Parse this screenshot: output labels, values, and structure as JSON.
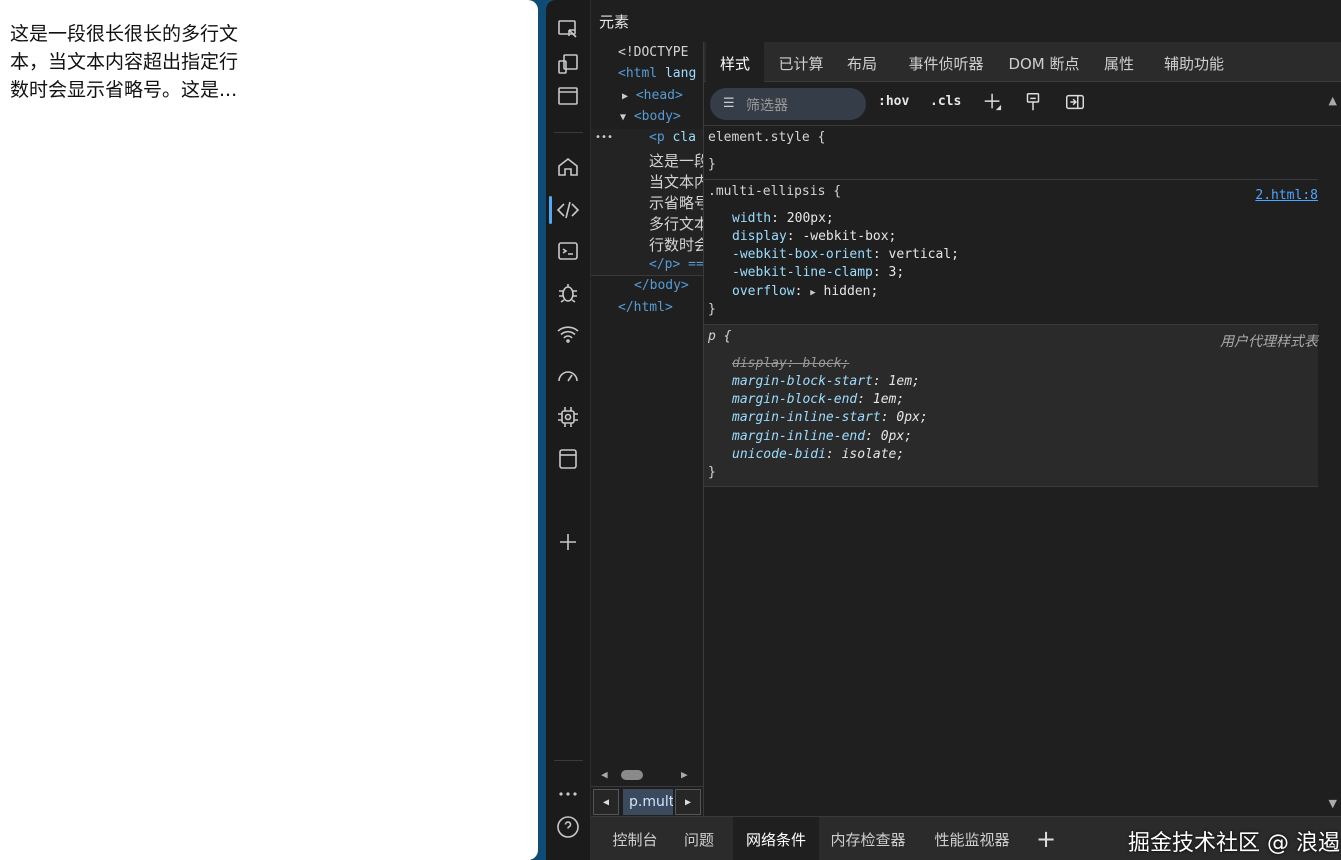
{
  "page": {
    "text": "这是一段很长很长的多行文\n本，当文本内容超出指定行\n数时会显示省略号。这是..."
  },
  "devtools": {
    "title": "元素",
    "dom": {
      "doctype": "<!DOCTYPE",
      "html_tag": "<html",
      "html_attr": "lang",
      "head": "<head>",
      "body": "<body>",
      "p_tag": "<p",
      "p_attr": "cla",
      "text_lines": [
        "这是一段",
        "当文本内",
        "示省略号",
        "多行文本",
        "行数时会"
      ],
      "p_close": "</p> ==",
      "body_close": "</body>",
      "html_close": "</html>",
      "ellipsis": "•••"
    },
    "breadcrumb": "p.mult",
    "style_tabs": [
      "样式",
      "已计算",
      "布局",
      "事件侦听器",
      "DOM 断点",
      "属性",
      "辅助功能"
    ],
    "filter_placeholder": "筛选器",
    "hov": ":hov",
    "cls": ".cls",
    "rules": {
      "element_style": "element.style {",
      "close": "}",
      "multi_selector": ".multi-ellipsis {",
      "multi_source": "2.html:8",
      "multi_decls": [
        {
          "name": "width",
          "value": "200px;"
        },
        {
          "name": "display",
          "value": "-webkit-box;"
        },
        {
          "name": "-webkit-box-orient",
          "value": "vertical;"
        },
        {
          "name": "-webkit-line-clamp",
          "value": "3;"
        },
        {
          "name": "overflow",
          "value": "hidden;"
        }
      ],
      "p_selector": "p {",
      "p_source": "用户代理样式表",
      "p_decls": [
        {
          "name": "display",
          "value": "block;"
        },
        {
          "name": "margin-block-start",
          "value": "1em;"
        },
        {
          "name": "margin-block-end",
          "value": "1em;"
        },
        {
          "name": "margin-inline-start",
          "value": "0px;"
        },
        {
          "name": "margin-inline-end",
          "value": "0px;"
        },
        {
          "name": "unicode-bidi",
          "value": "isolate;"
        }
      ]
    },
    "drawer_tabs": [
      "控制台",
      "问题",
      "网络条件",
      "内存检查器",
      "性能监视器"
    ],
    "watermark": "掘金技术社区 @ 浪遏"
  }
}
